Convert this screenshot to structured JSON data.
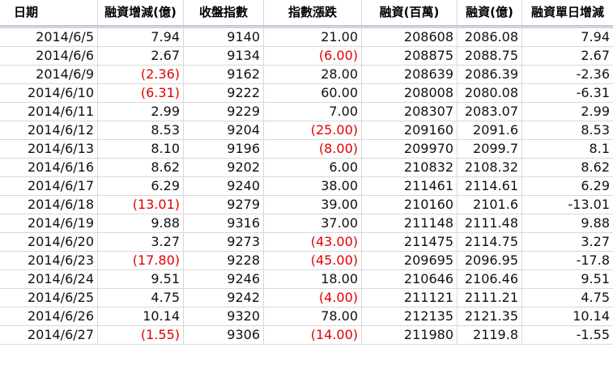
{
  "headers": [
    "日期",
    "融資增減(億)",
    "收盤指數",
    "指數漲跌",
    "融資(百萬)",
    "融資(億)",
    "融資單日增減"
  ],
  "colors": {
    "negative_text": "#e00000",
    "grid_line": "#d8d8d8",
    "header_separator": "#cfd6e2"
  },
  "rows": [
    {
      "date": "2014/6/5",
      "margin_change": "7.94",
      "margin_change_negative": false,
      "close": "9140",
      "index_change": "21.00",
      "index_change_negative": false,
      "margin_million": "208608",
      "margin_billion": "2086.08",
      "daily_change": "7.94"
    },
    {
      "date": "2014/6/6",
      "margin_change": "2.67",
      "margin_change_negative": false,
      "close": "9134",
      "index_change": "(6.00)",
      "index_change_negative": true,
      "margin_million": "208875",
      "margin_billion": "2088.75",
      "daily_change": "2.67"
    },
    {
      "date": "2014/6/9",
      "margin_change": "(2.36)",
      "margin_change_negative": true,
      "close": "9162",
      "index_change": "28.00",
      "index_change_negative": false,
      "margin_million": "208639",
      "margin_billion": "2086.39",
      "daily_change": "-2.36"
    },
    {
      "date": "2014/6/10",
      "margin_change": "(6.31)",
      "margin_change_negative": true,
      "close": "9222",
      "index_change": "60.00",
      "index_change_negative": false,
      "margin_million": "208008",
      "margin_billion": "2080.08",
      "daily_change": "-6.31"
    },
    {
      "date": "2014/6/11",
      "margin_change": "2.99",
      "margin_change_negative": false,
      "close": "9229",
      "index_change": "7.00",
      "index_change_negative": false,
      "margin_million": "208307",
      "margin_billion": "2083.07",
      "daily_change": "2.99"
    },
    {
      "date": "2014/6/12",
      "margin_change": "8.53",
      "margin_change_negative": false,
      "close": "9204",
      "index_change": "(25.00)",
      "index_change_negative": true,
      "margin_million": "209160",
      "margin_billion": "2091.6",
      "daily_change": "8.53"
    },
    {
      "date": "2014/6/13",
      "margin_change": "8.10",
      "margin_change_negative": false,
      "close": "9196",
      "index_change": "(8.00)",
      "index_change_negative": true,
      "margin_million": "209970",
      "margin_billion": "2099.7",
      "daily_change": "8.1"
    },
    {
      "date": "2014/6/16",
      "margin_change": "8.62",
      "margin_change_negative": false,
      "close": "9202",
      "index_change": "6.00",
      "index_change_negative": false,
      "margin_million": "210832",
      "margin_billion": "2108.32",
      "daily_change": "8.62"
    },
    {
      "date": "2014/6/17",
      "margin_change": "6.29",
      "margin_change_negative": false,
      "close": "9240",
      "index_change": "38.00",
      "index_change_negative": false,
      "margin_million": "211461",
      "margin_billion": "2114.61",
      "daily_change": "6.29"
    },
    {
      "date": "2014/6/18",
      "margin_change": "(13.01)",
      "margin_change_negative": true,
      "close": "9279",
      "index_change": "39.00",
      "index_change_negative": false,
      "margin_million": "210160",
      "margin_billion": "2101.6",
      "daily_change": "-13.01"
    },
    {
      "date": "2014/6/19",
      "margin_change": "9.88",
      "margin_change_negative": false,
      "close": "9316",
      "index_change": "37.00",
      "index_change_negative": false,
      "margin_million": "211148",
      "margin_billion": "2111.48",
      "daily_change": "9.88"
    },
    {
      "date": "2014/6/20",
      "margin_change": "3.27",
      "margin_change_negative": false,
      "close": "9273",
      "index_change": "(43.00)",
      "index_change_negative": true,
      "margin_million": "211475",
      "margin_billion": "2114.75",
      "daily_change": "3.27"
    },
    {
      "date": "2014/6/23",
      "margin_change": "(17.80)",
      "margin_change_negative": true,
      "close": "9228",
      "index_change": "(45.00)",
      "index_change_negative": true,
      "margin_million": "209695",
      "margin_billion": "2096.95",
      "daily_change": "-17.8"
    },
    {
      "date": "2014/6/24",
      "margin_change": "9.51",
      "margin_change_negative": false,
      "close": "9246",
      "index_change": "18.00",
      "index_change_negative": false,
      "margin_million": "210646",
      "margin_billion": "2106.46",
      "daily_change": "9.51"
    },
    {
      "date": "2014/6/25",
      "margin_change": "4.75",
      "margin_change_negative": false,
      "close": "9242",
      "index_change": "(4.00)",
      "index_change_negative": true,
      "margin_million": "211121",
      "margin_billion": "2111.21",
      "daily_change": "4.75"
    },
    {
      "date": "2014/6/26",
      "margin_change": "10.14",
      "margin_change_negative": false,
      "close": "9320",
      "index_change": "78.00",
      "index_change_negative": false,
      "margin_million": "212135",
      "margin_billion": "2121.35",
      "daily_change": "10.14"
    },
    {
      "date": "2014/6/27",
      "margin_change": "(1.55)",
      "margin_change_negative": true,
      "close": "9306",
      "index_change": "(14.00)",
      "index_change_negative": true,
      "margin_million": "211980",
      "margin_billion": "2119.8",
      "daily_change": "-1.55"
    }
  ]
}
